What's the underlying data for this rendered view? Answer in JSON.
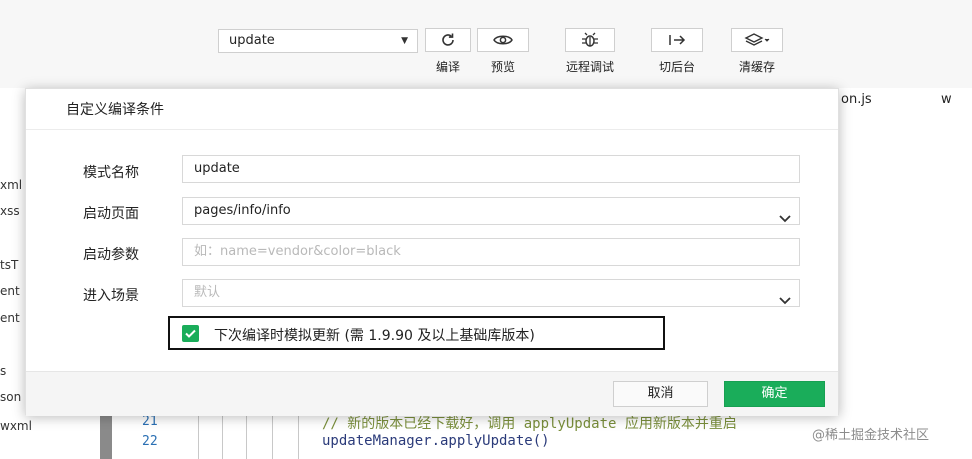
{
  "toolbar": {
    "mode_select_value": "update",
    "buttons": [
      {
        "label": "编译",
        "icon": "refresh-icon"
      },
      {
        "label": "预览",
        "icon": "eye-icon"
      },
      {
        "label": "远程调试",
        "icon": "bug-icon"
      },
      {
        "label": "切后台",
        "icon": "switch-background-icon"
      },
      {
        "label": "清缓存",
        "icon": "layers-icon"
      }
    ]
  },
  "editor": {
    "tabs": [
      "on.js",
      "w"
    ],
    "tree_items": [
      "xml",
      "xss",
      "tsT",
      "ent",
      "ent",
      "s",
      "son",
      "wxml"
    ],
    "line_numbers": [
      "21",
      "22"
    ],
    "code_lines": [
      "// 新的版本已经下载好，调用 applyUpdate 应用新版本并重启",
      "updateManager.applyUpdate()"
    ]
  },
  "dialog": {
    "title": "自定义编译条件",
    "fields": [
      {
        "label": "模式名称",
        "value": "update",
        "placeholder": ""
      },
      {
        "label": "启动页面",
        "value": "pages/info/info",
        "placeholder": ""
      },
      {
        "label": "启动参数",
        "value": "",
        "placeholder": "如：name=vendor&color=black"
      },
      {
        "label": "进入场景",
        "value": "",
        "placeholder": "默认"
      }
    ],
    "checkbox_label": "下次编译时模拟更新 (需 1.9.90 及以上基础库版本)",
    "checkbox_checked": true,
    "cancel_label": "取消",
    "ok_label": "确定"
  },
  "watermark": "@稀土掘金技术社区",
  "colors": {
    "accent_green": "#1aad5a",
    "code_comment": "#7a8f3b",
    "line_number": "#2a6fb3"
  }
}
